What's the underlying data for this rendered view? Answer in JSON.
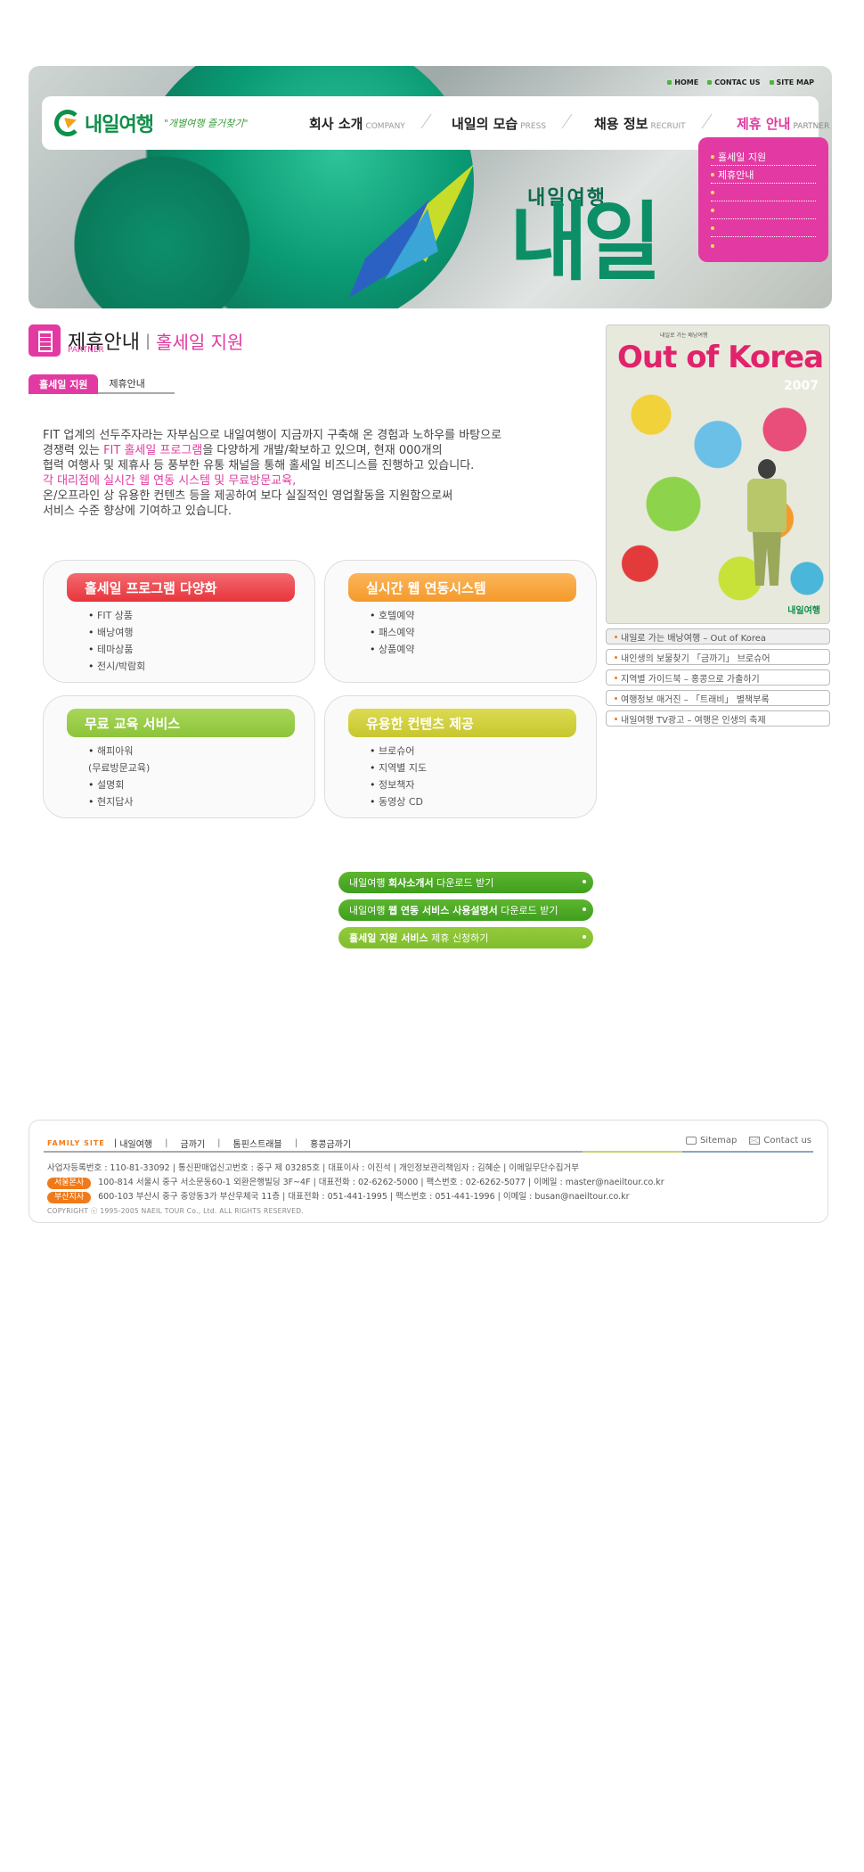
{
  "header": {
    "top_links": [
      "HOME",
      "CONTAC US",
      "SITE MAP"
    ],
    "logo_text": "내일여행",
    "slogan": "\"개별여행 즐거찾기\"",
    "sign_text": "내일",
    "sign_top": "내일여행",
    "nav": [
      {
        "label": "회사 소개",
        "en": "COMPANY"
      },
      {
        "label": "내일의 모습",
        "en": "PRESS"
      },
      {
        "label": "채용 정보",
        "en": "RECRUIT"
      },
      {
        "label": "제휴 안내",
        "en": "PARTNER"
      }
    ],
    "submenu": [
      "홀세일 지원",
      "제휴안내",
      "",
      "",
      "",
      ""
    ]
  },
  "page": {
    "title": "제휴안내",
    "separator": "|",
    "subtitle": "홀세일 지원",
    "title_en": "PARTNER",
    "tabs": [
      "홀세일 지원",
      "제휴안내"
    ]
  },
  "intro": {
    "l1": "FIT 업계의 선두주자라는 자부심으로 내일여행이 지금까지 구축해 온 경험과 노하우를 바탕으로",
    "l2a": "경쟁력 있는 ",
    "l2hl": "FIT 홀세일 프로그램",
    "l2b": "을 다양하게 개발/확보하고 있으며, 현재 000개의",
    "l3": "협력 여행사 및 제휴사 등 풍부한 유통 채널을 통해 홀세일 비즈니스를 진행하고 있습니다.",
    "l4": "각 대리점에 실시간 웹 연동 시스템 및 무료방문교육,",
    "l5": "온/오프라인 상 유용한 컨텐츠 등을 제공하여 보다 실질적인 영업활동을 지원함으로써",
    "l6": "서비스 수준 향상에 기여하고 있습니다."
  },
  "services": [
    {
      "title": "홀세일 프로그램 다양화",
      "items": [
        "FIT 상품",
        "배낭여행",
        "테마상품",
        "전시/박람회"
      ]
    },
    {
      "title": "실시간 웹 연동시스템",
      "items": [
        "호텔예약",
        "패스예약",
        "상품예약"
      ]
    },
    {
      "title": "무료 교육 서비스",
      "items": [
        "해피아워",
        "(무료방문교육)",
        "설명회",
        "현지답사"
      ]
    },
    {
      "title": "유용한 컨텐츠 제공",
      "items": [
        "브로슈어",
        "지역별 지도",
        "정보책자",
        "동영상 CD"
      ]
    }
  ],
  "downloads": [
    {
      "a": "내일여행 ",
      "b": "회사소개서",
      "c": " 다운로드 받기"
    },
    {
      "a": "내일여행 ",
      "b": "웹 연동 서비스 사용설명서",
      "c": " 다운로드 받기"
    },
    {
      "a": "",
      "b": "홀세일 지원 서비스",
      "c": " 제휴 신청하기"
    }
  ],
  "poster": {
    "small": "내일로 가는 배낭여행",
    "title": "Out of Korea",
    "year": "2007",
    "logo": "내일여행"
  },
  "right_links": [
    "내일로 가는 배낭여행 – Out of Korea",
    "내인생의 보물찾기 「금까기」 브로슈어",
    "지역별 가이드북 – 홍콩으로 가출하기",
    "여행정보 매거진 – 「트래비」 별책부록",
    "내일여행 TV광고 – 여행은 인생의 축제"
  ],
  "footer": {
    "family_label": "FAMILY SITE",
    "family_sites": [
      "내일여행",
      "금까기",
      "톰핀스트래블",
      "홍콩금까기"
    ],
    "utils": [
      "Sitemap",
      "Contact us"
    ],
    "biz_line": "사업자등록번호 : 110-81-33092 | 통신판매업신고번호 : 중구 제 03285호 | 대표이사 : 이진석 | 개인정보관리책임자 : 김혜순 | 이메일무단수집거부",
    "seoul_badge": "서울본사",
    "seoul_line": "100-814 서울시 중구 서소문동60-1 외환은행빌딩 3F~4F | 대표전화 : 02-6262-5000 | 팩스번호 : 02-6262-5077 | 이메일 : master@naeiltour.co.kr",
    "busan_badge": "부산지사",
    "busan_line": "600-103 부산시 중구 중앙동3가 부산우체국 11층 | 대표전화 : 051-441-1995 | 팩스번호 : 051-441-1996 | 이메일 : busan@naeiltour.co.kr",
    "copyright": "COPYRIGHT ⓒ 1995-2005 NAEIL TOUR Co., Ltd. ALL RIGHTS RESERVED."
  },
  "colors": {
    "accent": "#e23aa2",
    "red_head": "#e8343c",
    "orange_head": "#f59a2a",
    "green_head": "#8cc43a",
    "olive_head": "#c7c62e",
    "dl_green": "#3f9f1e",
    "dl_light": "#7fbd2c"
  }
}
